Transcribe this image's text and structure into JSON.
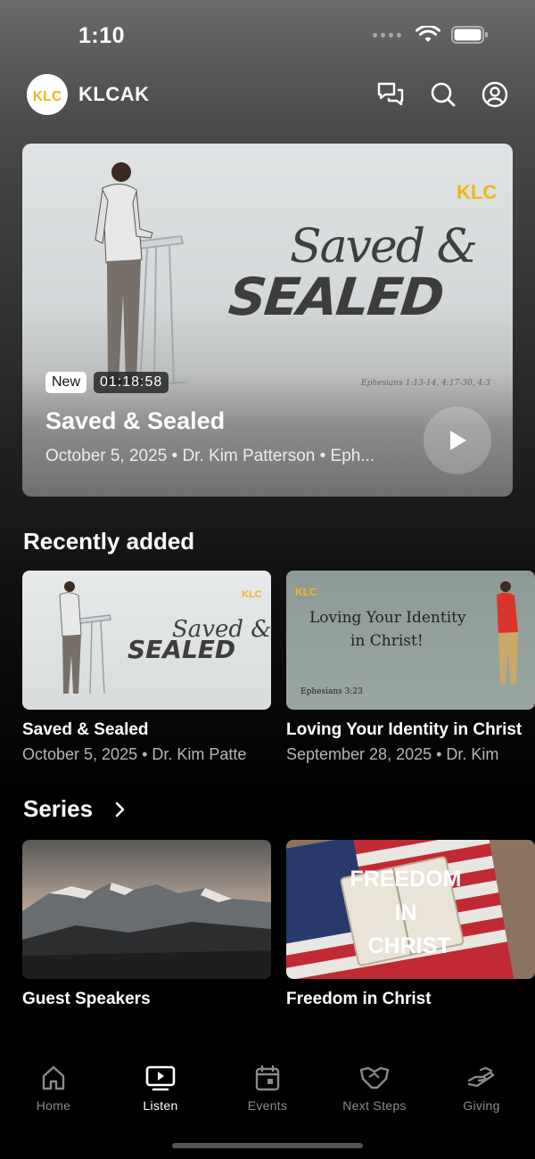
{
  "status_bar": {
    "time": "1:10"
  },
  "header": {
    "app_name": "KLCAK",
    "logo_text": "KLC"
  },
  "hero": {
    "art_script": "Saved &",
    "art_bold": "SEALED",
    "art_reference": "Ephesians 1:13-14, 4:17-30, 4:3",
    "badge_new": "New",
    "duration": "01:18:58",
    "title": "Saved & Sealed",
    "meta": "October 5, 2025 • Dr. Kim Patterson • Eph..."
  },
  "recently_added": {
    "heading": "Recently added",
    "items": [
      {
        "title": "Saved & Sealed",
        "meta": "October 5, 2025 • Dr. Kim Patte",
        "art_script": "Saved &",
        "art_bold": "SEALED"
      },
      {
        "title": "Loving Your Identity in Christ",
        "meta": "September 28, 2025 • Dr. Kim",
        "art_line1": "Loving Your Identity",
        "art_line2": "in Christ!",
        "art_ref": "Ephesians 3:23"
      }
    ]
  },
  "series": {
    "heading": "Series",
    "items": [
      {
        "title": "Guest Speakers"
      },
      {
        "title": "Freedom in Christ",
        "art_line1": "FREEDOM",
        "art_line2": "IN",
        "art_line3": "CHRIST"
      }
    ]
  },
  "bottom_nav": {
    "items": [
      {
        "label": "Home",
        "icon": "home-icon",
        "active": false
      },
      {
        "label": "Listen",
        "icon": "listen-icon",
        "active": true
      },
      {
        "label": "Events",
        "icon": "calendar-icon",
        "active": false
      },
      {
        "label": "Next Steps",
        "icon": "handshake-icon",
        "active": false
      },
      {
        "label": "Giving",
        "icon": "giving-icon",
        "active": false
      }
    ]
  },
  "colors": {
    "accent": "#f2b51e",
    "background": "#000000"
  }
}
